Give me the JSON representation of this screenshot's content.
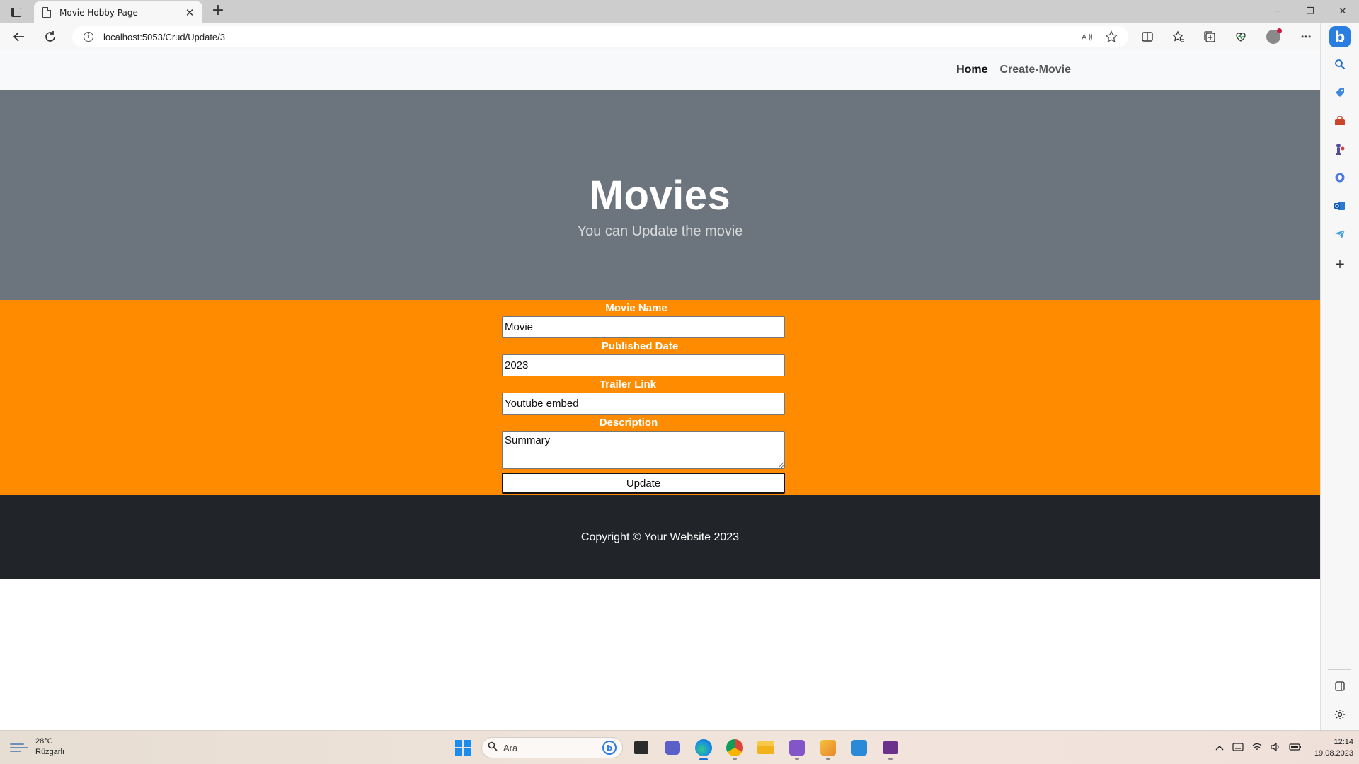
{
  "browser": {
    "tab_title": "Movie Hobby Page",
    "tab_close": "✕",
    "new_tab": "+",
    "url": "localhost:5053/Crud/Update/3",
    "window_controls": {
      "minimize": "─",
      "restore": "❐",
      "close": "✕"
    }
  },
  "site": {
    "nav": {
      "home": "Home",
      "create": "Create-Movie"
    },
    "hero": {
      "title": "Movies",
      "subtitle": "You can Update the movie"
    },
    "form": {
      "movie_name_label": "Movie Name",
      "movie_name_value": "Movie",
      "published_date_label": "Published Date",
      "published_date_value": "2023",
      "trailer_link_label": "Trailer Link",
      "trailer_link_value": "Youtube embed",
      "description_label": "Description",
      "description_value": "Summary",
      "submit_label": "Update"
    },
    "footer": {
      "copyright": "Copyright © Your Website 2023"
    }
  },
  "taskbar": {
    "weather_temp": "28°C",
    "weather_desc": "Rüzgarlı",
    "search_placeholder": "Ara",
    "time": "12:14",
    "date": "19.08.2023"
  },
  "colors": {
    "hero_bg": "#6c757d",
    "form_bg": "#ff8c00",
    "footer_bg": "#212529",
    "nav_bg": "#f8f9fa"
  }
}
